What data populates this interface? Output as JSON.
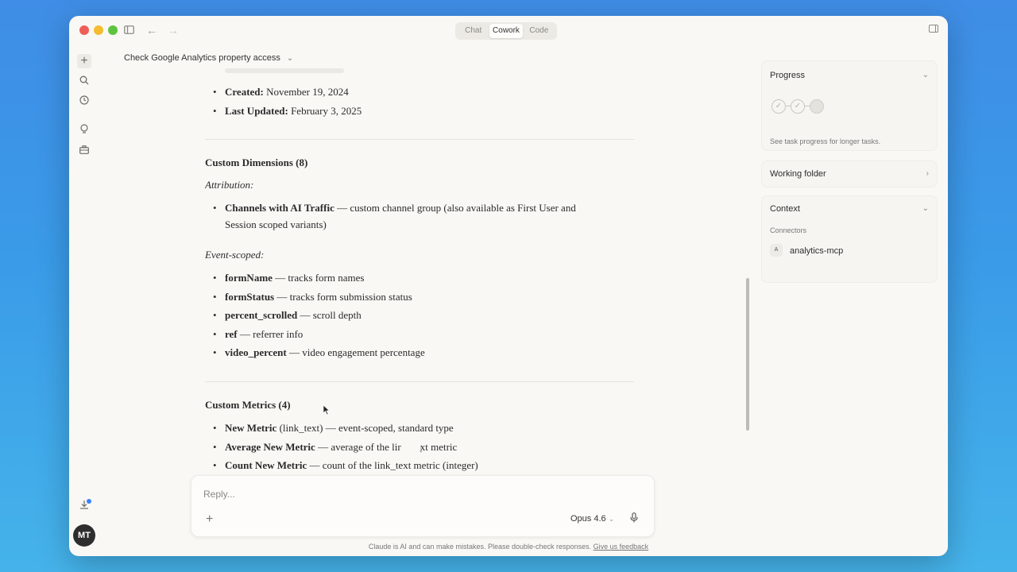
{
  "window": {
    "mode_tabs": [
      "Chat",
      "Cowork",
      "Code"
    ],
    "active_tab": "Cowork"
  },
  "conversation": {
    "title": "Check Google Analytics property access"
  },
  "content": {
    "created_label": "Created:",
    "created_value": "November 19, 2024",
    "updated_label": "Last Updated:",
    "updated_value": "February 3, 2025",
    "custom_dimensions_heading": "Custom Dimensions (8)",
    "attribution_label": "Attribution:",
    "attribution_item_name": "Channels with AI Traffic",
    "attribution_item_desc": " — custom channel group (also available as First User and",
    "attribution_item_desc2": "Session scoped variants)",
    "event_scoped_label": "Event-scoped:",
    "event_items": [
      {
        "name": "formName",
        "desc": " — tracks form names"
      },
      {
        "name": "formStatus",
        "desc": " — tracks form submission status"
      },
      {
        "name": "percent_scrolled",
        "desc": " — scroll depth"
      },
      {
        "name": "ref",
        "desc": " — referrer info"
      },
      {
        "name": "video_percent",
        "desc": " — video engagement percentage"
      }
    ],
    "custom_metrics_heading": "Custom Metrics (4)",
    "metric_items": [
      {
        "name": "New Metric",
        "desc": " (link_text) — event-scoped, standard type"
      },
      {
        "name": "Average New Metric",
        "desc": " — average of the lir",
        "desc_tail": "xt metric"
      },
      {
        "name": "Count New Metric",
        "desc": " — count of the link_text metric (integer)"
      }
    ]
  },
  "right_panel": {
    "progress_title": "Progress",
    "progress_note": "See task progress for longer tasks.",
    "progress_steps_completed": 2,
    "progress_steps_total": 3,
    "working_folder_title": "Working folder",
    "context_title": "Context",
    "connectors_label": "Connectors",
    "connector_name": "analytics-mcp",
    "connector_badge": "A"
  },
  "composer": {
    "placeholder": "Reply...",
    "model": "Opus 4.6"
  },
  "footer": {
    "disclaimer": "Claude is AI and can make mistakes. Please double-check responses.",
    "feedback_link": "Give us feedback"
  },
  "user": {
    "initials": "MT"
  }
}
